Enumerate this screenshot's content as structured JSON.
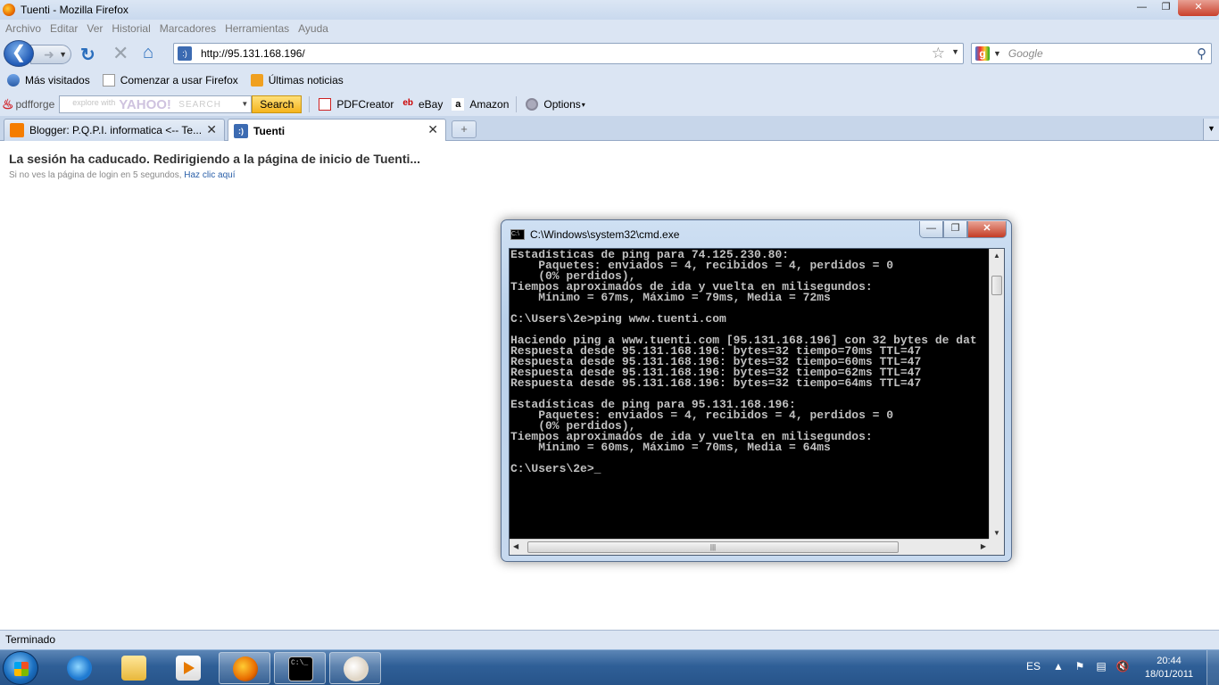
{
  "browser": {
    "window_title": "Tuenti - Mozilla Firefox",
    "menu": [
      "Archivo",
      "Editar",
      "Ver",
      "Historial",
      "Marcadores",
      "Herramientas",
      "Ayuda"
    ],
    "url": "http://95.131.168.196/",
    "search_placeholder": "Google",
    "bookmarks": [
      "Más visitados",
      "Comenzar a usar Firefox",
      "Últimas noticias"
    ],
    "pdfbar": {
      "brand": "pdfforge",
      "search_placeholder": "explore with",
      "search_brand": "YAHOO!",
      "search_word": "SEARCH",
      "search_button": "Search",
      "items": [
        "PDFCreator",
        "eBay",
        "Amazon",
        "Options"
      ]
    },
    "tabs": [
      {
        "title": "Blogger: P.Q.P.I. informatica <-- Te..."
      },
      {
        "title": "Tuenti"
      }
    ],
    "status": "Terminado"
  },
  "page": {
    "heading": "La sesión ha caducado. Redirigiendo a la página de inicio de Tuenti...",
    "subtext": "Si no ves la página de login en 5 segundos,",
    "link": "Haz clic aquí"
  },
  "cmd": {
    "title": "C:\\Windows\\system32\\cmd.exe",
    "output": "Estadísticas de ping para 74.125.230.80:\n    Paquetes: enviados = 4, recibidos = 4, perdidos = 0\n    (0% perdidos),\nTiempos aproximados de ida y vuelta en milisegundos:\n    Mínimo = 67ms, Máximo = 79ms, Media = 72ms\n\nC:\\Users\\2e>ping www.tuenti.com\n\nHaciendo ping a www.tuenti.com [95.131.168.196] con 32 bytes de dat\nRespuesta desde 95.131.168.196: bytes=32 tiempo=70ms TTL=47\nRespuesta desde 95.131.168.196: bytes=32 tiempo=60ms TTL=47\nRespuesta desde 95.131.168.196: bytes=32 tiempo=62ms TTL=47\nRespuesta desde 95.131.168.196: bytes=32 tiempo=64ms TTL=47\n\nEstadísticas de ping para 95.131.168.196:\n    Paquetes: enviados = 4, recibidos = 4, perdidos = 0\n    (0% perdidos),\nTiempos aproximados de ida y vuelta en milisegundos:\n    Mínimo = 60ms, Máximo = 70ms, Media = 64ms\n\nC:\\Users\\2e>_"
  },
  "taskbar": {
    "language": "ES",
    "time": "20:44",
    "date": "18/01/2011"
  }
}
